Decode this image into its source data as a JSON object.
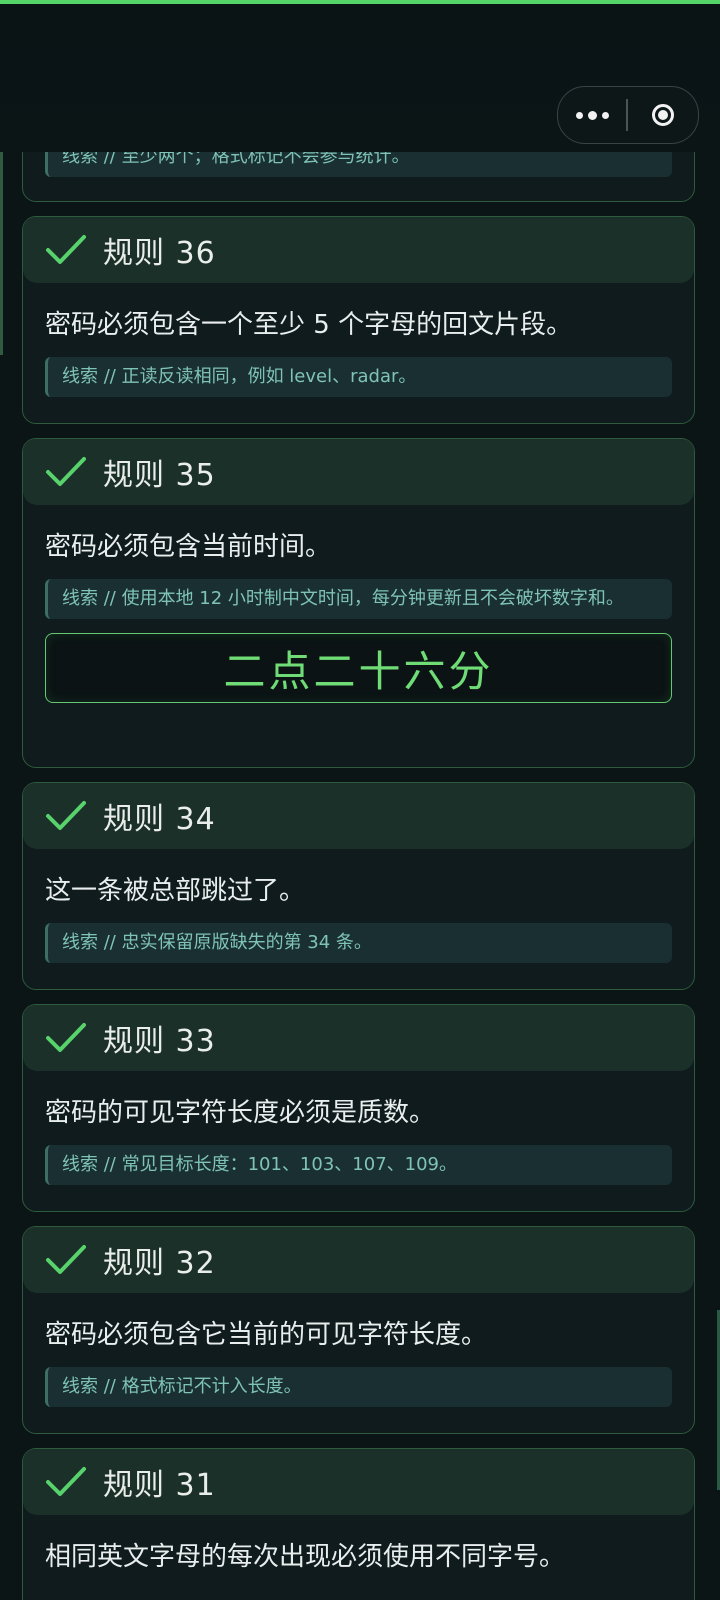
{
  "header": {
    "more_icon": "more-dots-icon",
    "close_icon": "target-close-icon"
  },
  "partial_clue": "线索 // 至少两个；格式标记不会参与统计。",
  "rules": [
    {
      "title": "规则 36",
      "description": "密码必须包含一个至少 5 个字母的回文片段。",
      "clue": "线索 // 正读反读相同，例如 level、radar。"
    },
    {
      "title": "规则 35",
      "description": "密码必须包含当前时间。",
      "clue": "线索 // 使用本地 12 小时制中文时间，每分钟更新且不会破坏数字和。",
      "time": "二点二十六分"
    },
    {
      "title": "规则 34",
      "description": "这一条被总部跳过了。",
      "clue": "线索 // 忠实保留原版缺失的第 34 条。"
    },
    {
      "title": "规则 33",
      "description": "密码的可见字符长度必须是质数。",
      "clue": "线索 // 常见目标长度：101、103、107、109。"
    },
    {
      "title": "规则 32",
      "description": "密码必须包含它当前的可见字符长度。",
      "clue": "线索 // 格式标记不计入长度。"
    },
    {
      "title": "规则 31",
      "description": "相同英文字母的每次出现必须使用不同字号。"
    }
  ],
  "colors": {
    "accent": "#55d46a",
    "card_border": "#2e5a3d",
    "clue_text": "#7fc3b7"
  }
}
